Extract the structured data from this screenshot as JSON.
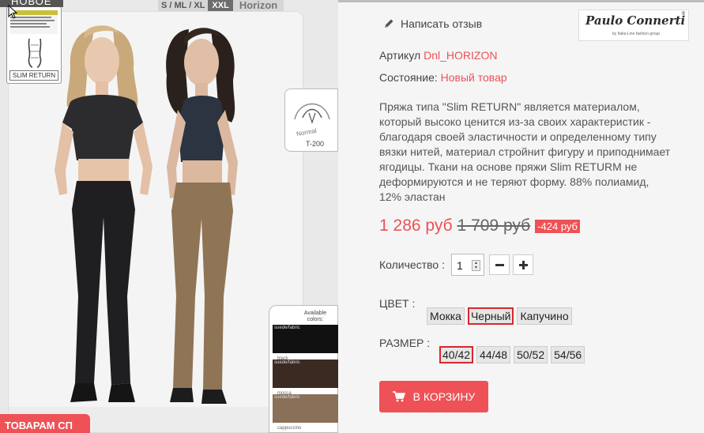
{
  "image": {
    "new_badge": "НОВОЕ",
    "sizes_tab": "S / ML / XL",
    "xxl_tab": "XXL",
    "brand_tab": "Horizon",
    "slim_label": "SLIM RETURN",
    "normal_label": "Normal",
    "model_code": "T-200",
    "colors_title": "Available colors:",
    "swatches": [
      {
        "top": "suede/fabric",
        "bottom": "black",
        "color": "#111111"
      },
      {
        "top": "suede/fabric",
        "bottom": "mocca",
        "color": "#3a2a22"
      },
      {
        "top": "suede/fabric",
        "bottom": "cappuccino",
        "color": "#8a7058"
      }
    ],
    "promo_ribbon": "ТОВАРАМ СП"
  },
  "review": {
    "label": "Написать отзыв"
  },
  "logo": {
    "text": "Paulo Connerti",
    "sub": "by Italia-Line fashion group",
    "reg": "®"
  },
  "article": {
    "label": "Артикул",
    "value": "Dnl_HORIZON"
  },
  "condition": {
    "label": "Состояние:",
    "value": "Новый товар"
  },
  "description": "Пряжа типа \"Slim RETURN\" является материалом, который высоко ценится из-за своих характеристик - благодаря своей эластичности и определенному типу вязки нитей, материал стройнит фигуру и приподнимает ягодицы. Ткани на основе пряжи Slim RETURM не деформируются и не теряют форму. 88% полиамид, 12% эластан",
  "price": {
    "current": "1 286 руб",
    "old": "1 709 руб",
    "discount": "-424 руб"
  },
  "quantity": {
    "label": "Количество :",
    "value": "1"
  },
  "color": {
    "label": "ЦВЕТ :",
    "options": [
      "Мокка",
      "Черный",
      "Капучино"
    ],
    "selected": "Черный"
  },
  "size": {
    "label": "РАЗМЕР :",
    "options": [
      "40/42",
      "44/48",
      "50/52",
      "54/56"
    ],
    "selected": "40/42"
  },
  "cart": {
    "label": "В КОРЗИНУ"
  },
  "colors": {
    "accent": "#ee5156",
    "selected_border": "#d9262f"
  }
}
